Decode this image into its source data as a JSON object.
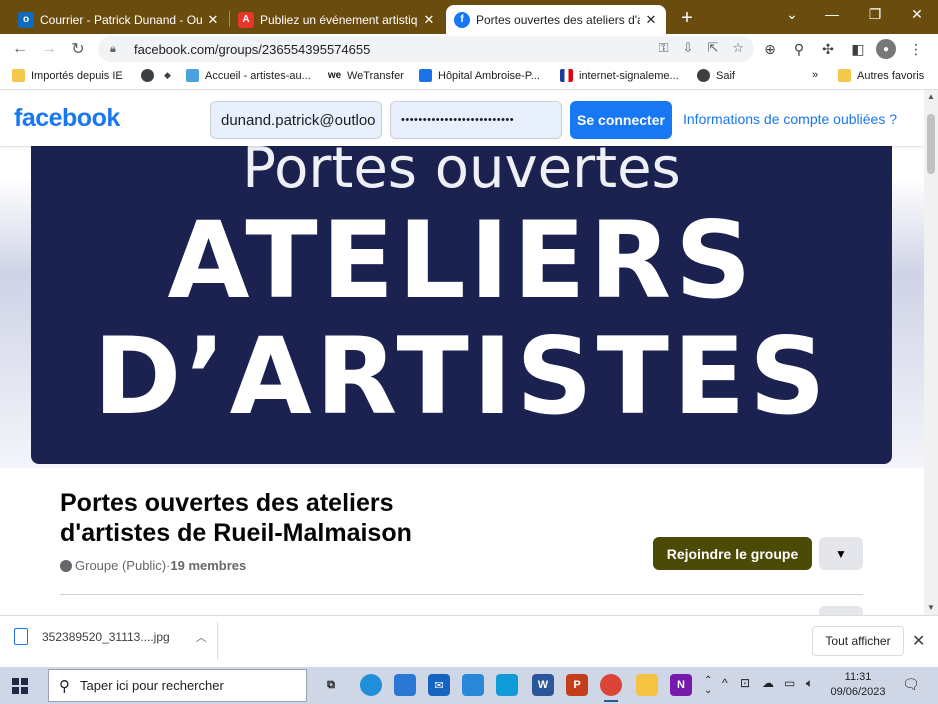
{
  "browser": {
    "tabs": [
      {
        "title": "Courrier - Patrick Dunand - Outlo",
        "icon": "outlook-icon"
      },
      {
        "title": "Publiez un événement artistique",
        "icon": "adobe-icon"
      },
      {
        "title": "Portes ouvertes des ateliers d'arti",
        "icon": "facebook-icon",
        "active": true
      }
    ],
    "url": "facebook.com/groups/236554395574655",
    "bookmarks": [
      {
        "label": "Importés depuis IE",
        "icon": "folder-icon"
      },
      {
        "label": "",
        "icon": "globe-icon"
      },
      {
        "label": "",
        "icon": "diamond-icon"
      },
      {
        "label": "Accueil - artistes-au...",
        "icon": "butterfly-icon"
      },
      {
        "label": "WeTransfer",
        "icon": "wetransfer-icon"
      },
      {
        "label": "Hôpital Ambroise-P...",
        "icon": "hospital-icon"
      },
      {
        "label": "internet-signaleme...",
        "icon": "flag-icon"
      },
      {
        "label": "Saif",
        "icon": "globe-icon"
      }
    ],
    "bookmarks_more": "»",
    "other_bookmarks": "Autres favoris"
  },
  "facebook": {
    "logo": "facebook",
    "email_value": "dunand.patrick@outloo",
    "password_value": "••••••••••••••••••••••••••",
    "login_label": "Se connecter",
    "forgot_label": "Informations de compte oubliées ?",
    "cover": {
      "line1": "Portes ouvertes",
      "line2": "ATELIERS",
      "line3": "D’ARTISTES",
      "background": "#1b2250"
    },
    "group": {
      "title": "Portes ouvertes des ateliers d'artistes de Rueil-Malmaison",
      "privacy": "Groupe (Public)",
      "separator": " · ",
      "members": "19 membres",
      "join_label": "Rejoindre le groupe",
      "join_color": "#4b4a07"
    }
  },
  "downloads": {
    "filename": "352389520_31113....jpg",
    "show_all": "Tout afficher"
  },
  "taskbar": {
    "search_placeholder": "Taper ici pour rechercher",
    "time": "11:31",
    "date": "09/06/2023"
  }
}
